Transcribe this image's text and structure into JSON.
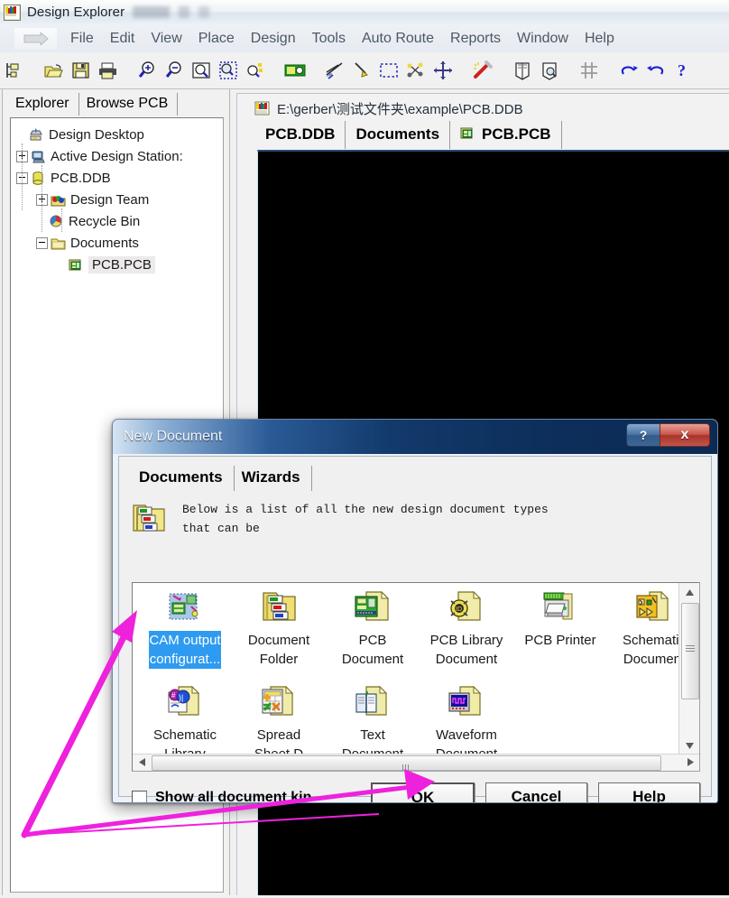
{
  "app": {
    "title": "Design Explorer",
    "icon": "app-logo-icon",
    "title_suffix_blurred": ""
  },
  "menubar": {
    "handle_icon": "menu-dropdown-arrow-icon",
    "items": [
      {
        "label": "File"
      },
      {
        "label": "Edit"
      },
      {
        "label": "View"
      },
      {
        "label": "Place"
      },
      {
        "label": "Design"
      },
      {
        "label": "Tools"
      },
      {
        "label": "Auto Route"
      },
      {
        "label": "Reports"
      },
      {
        "label": "Window"
      },
      {
        "label": "Help"
      }
    ]
  },
  "toolbar": {
    "buttons": [
      {
        "name": "new-document-icon",
        "title": "New"
      },
      {
        "name": "open-folder-icon",
        "title": "Open"
      },
      {
        "name": "save-icon",
        "title": "Save"
      },
      {
        "name": "print-icon",
        "title": "Print"
      },
      {
        "name": "zoom-in-icon",
        "title": "Zoom In"
      },
      {
        "name": "zoom-out-icon",
        "title": "Zoom Out"
      },
      {
        "name": "zoom-document-icon",
        "title": "Zoom Document"
      },
      {
        "name": "zoom-area-icon",
        "title": "Zoom Area"
      },
      {
        "name": "zoom-selected-icon",
        "title": "Zoom Selected"
      },
      {
        "name": "browse-component-icon",
        "title": "Browse"
      },
      {
        "name": "cut-tracks-icon",
        "title": "Cut Tracks"
      },
      {
        "name": "move-track-icon",
        "title": "Move"
      },
      {
        "name": "select-area-icon",
        "title": "Select Area"
      },
      {
        "name": "move-selection-icon",
        "title": "Move Selection"
      },
      {
        "name": "cross-move-icon",
        "title": "Move Cross"
      },
      {
        "name": "magic-wand-icon",
        "title": "Interactive"
      },
      {
        "name": "library-icon",
        "title": "Library"
      },
      {
        "name": "library-find-icon",
        "title": "Find Library"
      },
      {
        "name": "grid-icon",
        "title": "Grid"
      },
      {
        "name": "undo-icon",
        "title": "Undo"
      },
      {
        "name": "redo-icon",
        "title": "Redo"
      },
      {
        "name": "help-question-icon",
        "title": "Help"
      }
    ]
  },
  "left_panel": {
    "tabs": [
      {
        "label": "Explorer",
        "active": true
      },
      {
        "label": "Browse PCB",
        "active": false
      }
    ],
    "tree": [
      {
        "label": "Design Desktop",
        "indent": 0,
        "expander": "none",
        "icon": "design-desktop-icon",
        "selected": false
      },
      {
        "label": "Active Design Station:",
        "indent": 0,
        "expander": "plus",
        "icon": "design-station-icon",
        "selected": false
      },
      {
        "label": "PCB.DDB",
        "indent": 0,
        "expander": "minus",
        "icon": "database-icon",
        "selected": false
      },
      {
        "label": "Design Team",
        "indent": 1,
        "expander": "plus",
        "icon": "design-team-folder-icon",
        "selected": false
      },
      {
        "label": "Recycle Bin",
        "indent": 1,
        "expander": "none",
        "icon": "recycle-bin-icon",
        "selected": false
      },
      {
        "label": "Documents",
        "indent": 1,
        "expander": "minus",
        "icon": "folder-icon",
        "selected": false
      },
      {
        "label": "PCB.PCB",
        "indent": 2,
        "expander": "none",
        "icon": "pcb-file-icon",
        "selected": true
      }
    ]
  },
  "document_window": {
    "icon": "ddb-file-icon",
    "path_title": "E:\\gerber\\测试文件夹\\example\\PCB.DDB",
    "tabs": [
      {
        "label": "PCB.DDB",
        "icon": null,
        "active": false
      },
      {
        "label": "Documents",
        "icon": null,
        "active": false
      },
      {
        "label": "PCB.PCB",
        "icon": "pcb-file-icon",
        "active": true
      }
    ],
    "canvas_color": "#000000"
  },
  "dialog": {
    "title": "New Document",
    "help_button": "?",
    "close_button": "x",
    "tabs": [
      {
        "label": "Documents",
        "active": true
      },
      {
        "label": "Wizards",
        "active": false
      }
    ],
    "description_icon": "documents-stack-icon",
    "description": "Below is a list of all the new design document types\nthat can be",
    "items": [
      {
        "label": "CAM output\nconfigurat...",
        "icon": "cam-output-icon",
        "selected": true
      },
      {
        "label": "Document\nFolder",
        "icon": "document-folder-icon",
        "selected": false
      },
      {
        "label": "PCB\nDocument",
        "icon": "pcb-document-icon",
        "selected": false
      },
      {
        "label": "PCB Library\nDocument",
        "icon": "pcb-library-icon",
        "selected": false
      },
      {
        "label": "PCB Printer",
        "icon": "pcb-printer-icon",
        "selected": false
      },
      {
        "label": "Schematic\nDocument",
        "icon": "schematic-document-icon",
        "selected": false
      },
      {
        "label": "Schematic\nLibrary",
        "icon": "schematic-library-icon",
        "selected": false
      },
      {
        "label": "Spread\nSheet D",
        "icon": "spreadsheet-icon",
        "selected": false
      },
      {
        "label": "Text\nDocument",
        "icon": "text-document-icon",
        "selected": false
      },
      {
        "label": "Waveform\nDocument",
        "icon": "waveform-document-icon",
        "selected": false
      }
    ],
    "checkbox": {
      "label": "Show all document kin",
      "checked": false
    },
    "buttons": [
      {
        "label": "OK",
        "default": true
      },
      {
        "label": "Cancel",
        "default": false
      },
      {
        "label": "Help",
        "default": false
      }
    ],
    "scrollbar": {
      "vertical_up_icon": "scroll-up-arrow-icon",
      "vertical_down_icon": "scroll-down-arrow-icon",
      "horizontal_left_icon": "scroll-left-arrow-icon",
      "horizontal_right_icon": "scroll-right-arrow-icon"
    }
  },
  "annotations": {
    "color": "#ee22dd",
    "arrow_to_item": "CAM output configurat...",
    "arrow_to_button": "OK"
  }
}
